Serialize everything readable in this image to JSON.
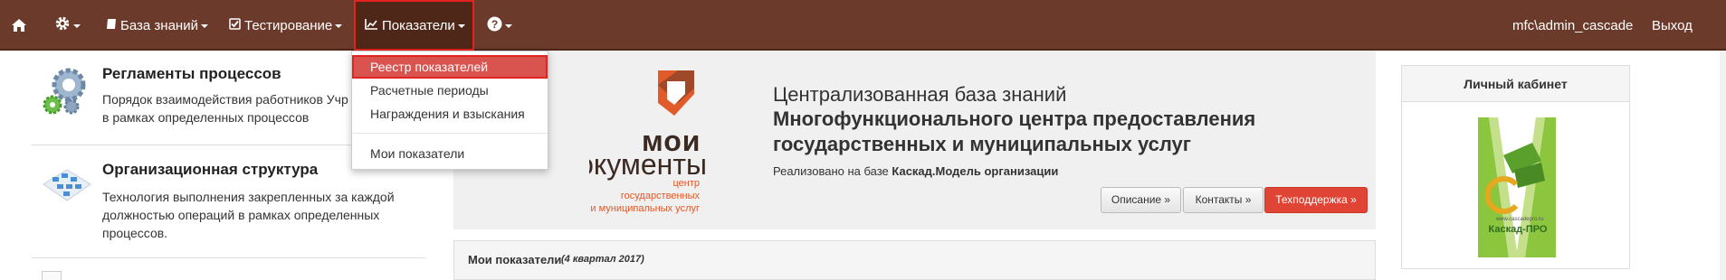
{
  "navbar": {
    "knowledge_base": "База знаний",
    "testing": "Тестирование",
    "indicators": "Показатели",
    "user": "mfc\\admin_cascade",
    "logout": "Выход"
  },
  "dropdown": {
    "items": [
      "Реестр показателей",
      "Расчетные периоды",
      "Награждения и взыскания",
      "Мои показатели"
    ]
  },
  "left": [
    {
      "title": "Регламенты процессов",
      "desc": "Порядок взаимодействия работников Учр\nв рамках определенных процессов"
    },
    {
      "title": "Организационная структура",
      "desc": "Технология выполнения закрепленных за каждой\nдолжностью операций в рамках определенных\nпроцессов."
    }
  ],
  "banner": {
    "logo_word1": "мои",
    "logo_word2": "документы",
    "logo_sub": "центр\nгосударственных\nи муниципальных услуг",
    "heading": "Централизованная база знаний",
    "subheading": "Многофункционального центра предоставления\nгосударственных и муниципальных услуг",
    "based_prefix": "Реализовано на базе ",
    "based_bold": "Каскад.Модель организации",
    "btn_description": "Описание »",
    "btn_contacts": "Контакты »",
    "btn_support": "Техподдержка »"
  },
  "panel": {
    "title": "Мои показатели",
    "period": "(4 квартал 2017)"
  },
  "cabinet": {
    "title": "Личный кабинет",
    "logo_small": "www.cascadepro.ru",
    "logo_text": "Каскад-ПРО"
  },
  "colors": {
    "navbar": "#6b3a2a",
    "accent_red": "#e3231f",
    "logo_orange": "#e05a2a",
    "logo_green": "#5aa02c"
  }
}
